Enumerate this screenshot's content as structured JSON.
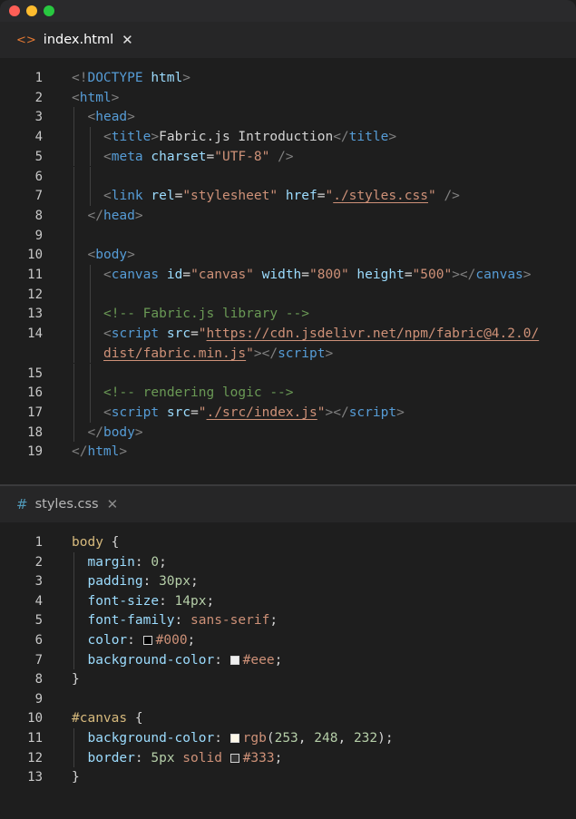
{
  "window": {
    "controls": [
      "close",
      "minimize",
      "maximize"
    ]
  },
  "tabs": [
    {
      "label": "index.html",
      "icon": "html-file-icon",
      "active": true
    },
    {
      "label": "styles.css",
      "icon": "css-file-icon",
      "active": false
    }
  ],
  "html_lines": [
    {
      "n": "1",
      "indent": 0,
      "tokens": [
        [
          "punc",
          "<!"
        ],
        [
          "tag",
          "DOCTYPE"
        ],
        [
          "text",
          " "
        ],
        [
          "attr",
          "html"
        ],
        [
          "punc",
          ">"
        ]
      ]
    },
    {
      "n": "2",
      "indent": 0,
      "tokens": [
        [
          "punc",
          "<"
        ],
        [
          "tag",
          "html"
        ],
        [
          "punc",
          ">"
        ]
      ]
    },
    {
      "n": "3",
      "indent": 1,
      "tokens": [
        [
          "punc",
          "<"
        ],
        [
          "tag",
          "head"
        ],
        [
          "punc",
          ">"
        ]
      ]
    },
    {
      "n": "4",
      "indent": 2,
      "tokens": [
        [
          "punc",
          "<"
        ],
        [
          "tag",
          "title"
        ],
        [
          "punc",
          ">"
        ],
        [
          "text",
          "Fabric.js Introduction"
        ],
        [
          "punc",
          "</"
        ],
        [
          "tag",
          "title"
        ],
        [
          "punc",
          ">"
        ]
      ]
    },
    {
      "n": "5",
      "indent": 2,
      "tokens": [
        [
          "punc",
          "<"
        ],
        [
          "tag",
          "meta"
        ],
        [
          "text",
          " "
        ],
        [
          "attr",
          "charset"
        ],
        [
          "text",
          "="
        ],
        [
          "str",
          "\"UTF-8\""
        ],
        [
          "text",
          " "
        ],
        [
          "punc",
          "/>"
        ]
      ]
    },
    {
      "n": "6",
      "indent": 2,
      "tokens": []
    },
    {
      "n": "7",
      "indent": 2,
      "tokens": [
        [
          "punc",
          "<"
        ],
        [
          "tag",
          "link"
        ],
        [
          "text",
          " "
        ],
        [
          "attr",
          "rel"
        ],
        [
          "text",
          "="
        ],
        [
          "str",
          "\"stylesheet\""
        ],
        [
          "text",
          " "
        ],
        [
          "attr",
          "href"
        ],
        [
          "text",
          "="
        ],
        [
          "str",
          "\""
        ],
        [
          "link",
          "./styles.css"
        ],
        [
          "str",
          "\""
        ],
        [
          "text",
          " "
        ],
        [
          "punc",
          "/>"
        ]
      ]
    },
    {
      "n": "8",
      "indent": 1,
      "tokens": [
        [
          "punc",
          "</"
        ],
        [
          "tag",
          "head"
        ],
        [
          "punc",
          ">"
        ]
      ]
    },
    {
      "n": "9",
      "indent": 1,
      "tokens": []
    },
    {
      "n": "10",
      "indent": 1,
      "tokens": [
        [
          "punc",
          "<"
        ],
        [
          "tag",
          "body"
        ],
        [
          "punc",
          ">"
        ]
      ]
    },
    {
      "n": "11",
      "indent": 2,
      "tokens": [
        [
          "punc",
          "<"
        ],
        [
          "tag",
          "canvas"
        ],
        [
          "text",
          " "
        ],
        [
          "attr",
          "id"
        ],
        [
          "text",
          "="
        ],
        [
          "str",
          "\"canvas\""
        ],
        [
          "text",
          " "
        ],
        [
          "attr",
          "width"
        ],
        [
          "text",
          "="
        ],
        [
          "str",
          "\"800\""
        ],
        [
          "text",
          " "
        ],
        [
          "attr",
          "height"
        ],
        [
          "text",
          "="
        ],
        [
          "str",
          "\"500\""
        ],
        [
          "punc",
          "></"
        ],
        [
          "tag",
          "canvas"
        ],
        [
          "punc",
          ">"
        ]
      ]
    },
    {
      "n": "12",
      "indent": 2,
      "tokens": []
    },
    {
      "n": "13",
      "indent": 2,
      "tokens": [
        [
          "comment",
          "<!-- Fabric.js library -->"
        ]
      ]
    },
    {
      "n": "14",
      "indent": 2,
      "tokens": [
        [
          "punc",
          "<"
        ],
        [
          "tag",
          "script"
        ],
        [
          "text",
          " "
        ],
        [
          "attr",
          "src"
        ],
        [
          "text",
          "="
        ],
        [
          "str",
          "\""
        ],
        [
          "link",
          "https://cdn.jsdelivr.net/npm/fabric@4.2.0/"
        ]
      ]
    },
    {
      "n": "",
      "indent": 2,
      "tokens": [
        [
          "link",
          "dist/fabric.min.js"
        ],
        [
          "str",
          "\""
        ],
        [
          "punc",
          "></"
        ],
        [
          "tag",
          "script"
        ],
        [
          "punc",
          ">"
        ]
      ]
    },
    {
      "n": "15",
      "indent": 2,
      "tokens": []
    },
    {
      "n": "16",
      "indent": 2,
      "tokens": [
        [
          "comment",
          "<!-- rendering logic -->"
        ]
      ]
    },
    {
      "n": "17",
      "indent": 2,
      "tokens": [
        [
          "punc",
          "<"
        ],
        [
          "tag",
          "script"
        ],
        [
          "text",
          " "
        ],
        [
          "attr",
          "src"
        ],
        [
          "text",
          "="
        ],
        [
          "str",
          "\""
        ],
        [
          "link",
          "./src/index.js"
        ],
        [
          "str",
          "\""
        ],
        [
          "punc",
          "></"
        ],
        [
          "tag",
          "script"
        ],
        [
          "punc",
          ">"
        ]
      ]
    },
    {
      "n": "18",
      "indent": 1,
      "tokens": [
        [
          "punc",
          "</"
        ],
        [
          "tag",
          "body"
        ],
        [
          "punc",
          ">"
        ]
      ]
    },
    {
      "n": "19",
      "indent": 0,
      "tokens": [
        [
          "punc",
          "</"
        ],
        [
          "tag",
          "html"
        ],
        [
          "punc",
          ">"
        ]
      ]
    }
  ],
  "css_lines": [
    {
      "n": "1",
      "indent": 0,
      "tokens": [
        [
          "sel",
          "body"
        ],
        [
          "brace",
          " {"
        ]
      ]
    },
    {
      "n": "2",
      "indent": 1,
      "tokens": [
        [
          "prop",
          "margin"
        ],
        [
          "text",
          ": "
        ],
        [
          "num",
          "0"
        ],
        [
          "text",
          ";"
        ]
      ]
    },
    {
      "n": "3",
      "indent": 1,
      "tokens": [
        [
          "prop",
          "padding"
        ],
        [
          "text",
          ": "
        ],
        [
          "num",
          "30px"
        ],
        [
          "text",
          ";"
        ]
      ]
    },
    {
      "n": "4",
      "indent": 1,
      "tokens": [
        [
          "prop",
          "font-size"
        ],
        [
          "text",
          ": "
        ],
        [
          "num",
          "14px"
        ],
        [
          "text",
          ";"
        ]
      ]
    },
    {
      "n": "5",
      "indent": 1,
      "tokens": [
        [
          "prop",
          "font-family"
        ],
        [
          "text",
          ": "
        ],
        [
          "val",
          "sans-serif"
        ],
        [
          "text",
          ";"
        ]
      ]
    },
    {
      "n": "6",
      "indent": 1,
      "tokens": [
        [
          "prop",
          "color"
        ],
        [
          "text",
          ": "
        ],
        [
          "swatch",
          "#000000"
        ],
        [
          "val",
          "#000"
        ],
        [
          "text",
          ";"
        ]
      ]
    },
    {
      "n": "7",
      "indent": 1,
      "tokens": [
        [
          "prop",
          "background-color"
        ],
        [
          "text",
          ": "
        ],
        [
          "swatch",
          "#eeeeee"
        ],
        [
          "val",
          "#eee"
        ],
        [
          "text",
          ";"
        ]
      ]
    },
    {
      "n": "8",
      "indent": 0,
      "tokens": [
        [
          "brace",
          "}"
        ]
      ]
    },
    {
      "n": "9",
      "indent": 0,
      "tokens": []
    },
    {
      "n": "10",
      "indent": 0,
      "tokens": [
        [
          "sel",
          "#canvas"
        ],
        [
          "brace",
          " {"
        ]
      ]
    },
    {
      "n": "11",
      "indent": 1,
      "tokens": [
        [
          "prop",
          "background-color"
        ],
        [
          "text",
          ": "
        ],
        [
          "swatch",
          "#fdf8e8"
        ],
        [
          "val",
          "rgb"
        ],
        [
          "text",
          "("
        ],
        [
          "num",
          "253"
        ],
        [
          "text",
          ", "
        ],
        [
          "num",
          "248"
        ],
        [
          "text",
          ", "
        ],
        [
          "num",
          "232"
        ],
        [
          "text",
          ");"
        ]
      ]
    },
    {
      "n": "12",
      "indent": 1,
      "tokens": [
        [
          "prop",
          "border"
        ],
        [
          "text",
          ": "
        ],
        [
          "num",
          "5px"
        ],
        [
          "text",
          " "
        ],
        [
          "val",
          "solid"
        ],
        [
          "text",
          " "
        ],
        [
          "swatch",
          "#333333"
        ],
        [
          "val",
          "#333"
        ],
        [
          "text",
          ";"
        ]
      ]
    },
    {
      "n": "13",
      "indent": 0,
      "tokens": [
        [
          "brace",
          "}"
        ]
      ]
    }
  ]
}
